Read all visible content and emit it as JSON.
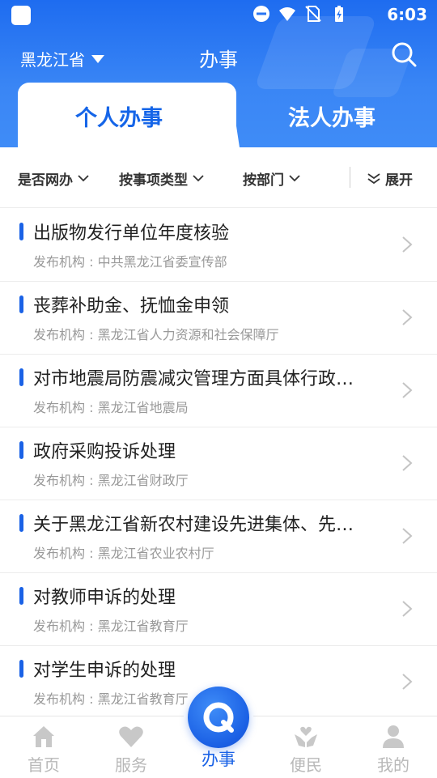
{
  "status_bar": {
    "time": "6:03"
  },
  "header": {
    "region": "黑龙江省",
    "title": "办事"
  },
  "tabs": [
    {
      "label": "个人办事",
      "active": true
    },
    {
      "label": "法人办事",
      "active": false
    }
  ],
  "filters": {
    "online": "是否网办",
    "type": "按事项类型",
    "dept": "按部门",
    "expand": "展开"
  },
  "items": [
    {
      "title": "出版物发行单位年度核验",
      "publisher": "发布机构 : 中共黑龙江省委宣传部"
    },
    {
      "title": "丧葬补助金、抚恤金申领",
      "publisher": "发布机构 : 黑龙江省人力资源和社会保障厅"
    },
    {
      "title": "对市地震局防震减灾管理方面具体行政…",
      "publisher": "发布机构 : 黑龙江省地震局"
    },
    {
      "title": "政府采购投诉处理",
      "publisher": "发布机构 : 黑龙江省财政厅"
    },
    {
      "title": "关于黑龙江省新农村建设先进集体、先…",
      "publisher": "发布机构 : 黑龙江省农业农村厅"
    },
    {
      "title": "对教师申诉的处理",
      "publisher": "发布机构 : 黑龙江省教育厅"
    },
    {
      "title": "对学生申诉的处理",
      "publisher": "发布机构 : 黑龙江省教育厅"
    }
  ],
  "bottom_nav": {
    "home": "首页",
    "service": "服务",
    "affairs": "办事",
    "convenience": "便民",
    "mine": "我的"
  },
  "colors": {
    "brand_blue": "#1a62e6",
    "inactive_gray": "#b8b8b8"
  }
}
